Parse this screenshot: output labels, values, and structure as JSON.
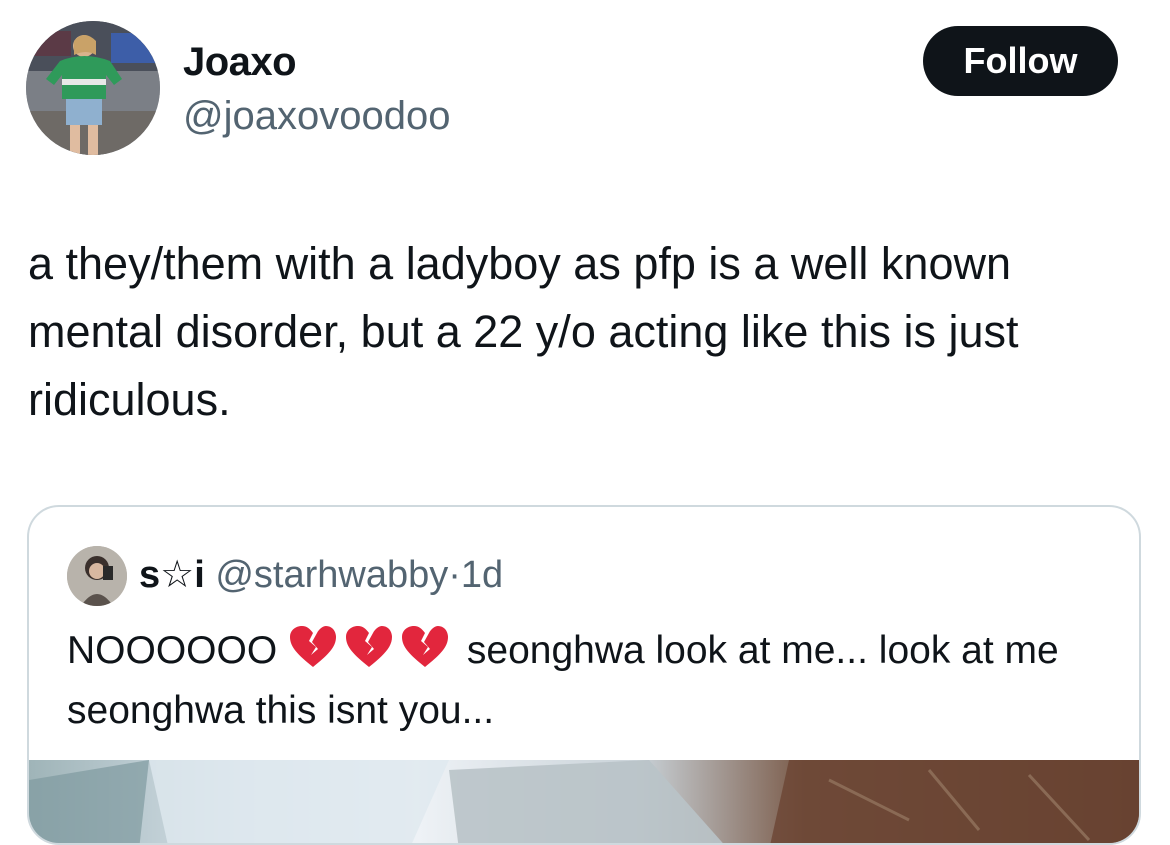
{
  "author": {
    "display_name": "Joaxo",
    "handle": "@joaxovoodoo"
  },
  "follow_label": "Follow",
  "tweet": {
    "text": "a they/them with a ladyboy as pfp is a well known mental disorder, but a 22 y/o acting like this is just ridiculous."
  },
  "quoted": {
    "display_name": "s☆i",
    "handle": "@starhwabby",
    "separator": "·",
    "time": "1d",
    "text_before": "NOOOOOO",
    "emojis": [
      "broken-heart-icon",
      "broken-heart-icon",
      "broken-heart-icon"
    ],
    "text_after": "seonghwa look at me... look at me seonghwa this isnt you..."
  },
  "colors": {
    "text_primary": "#0f1419",
    "text_secondary": "#536471",
    "follow_bg": "#0f1419",
    "border": "#cfd9de",
    "heart": "#e2263d"
  }
}
